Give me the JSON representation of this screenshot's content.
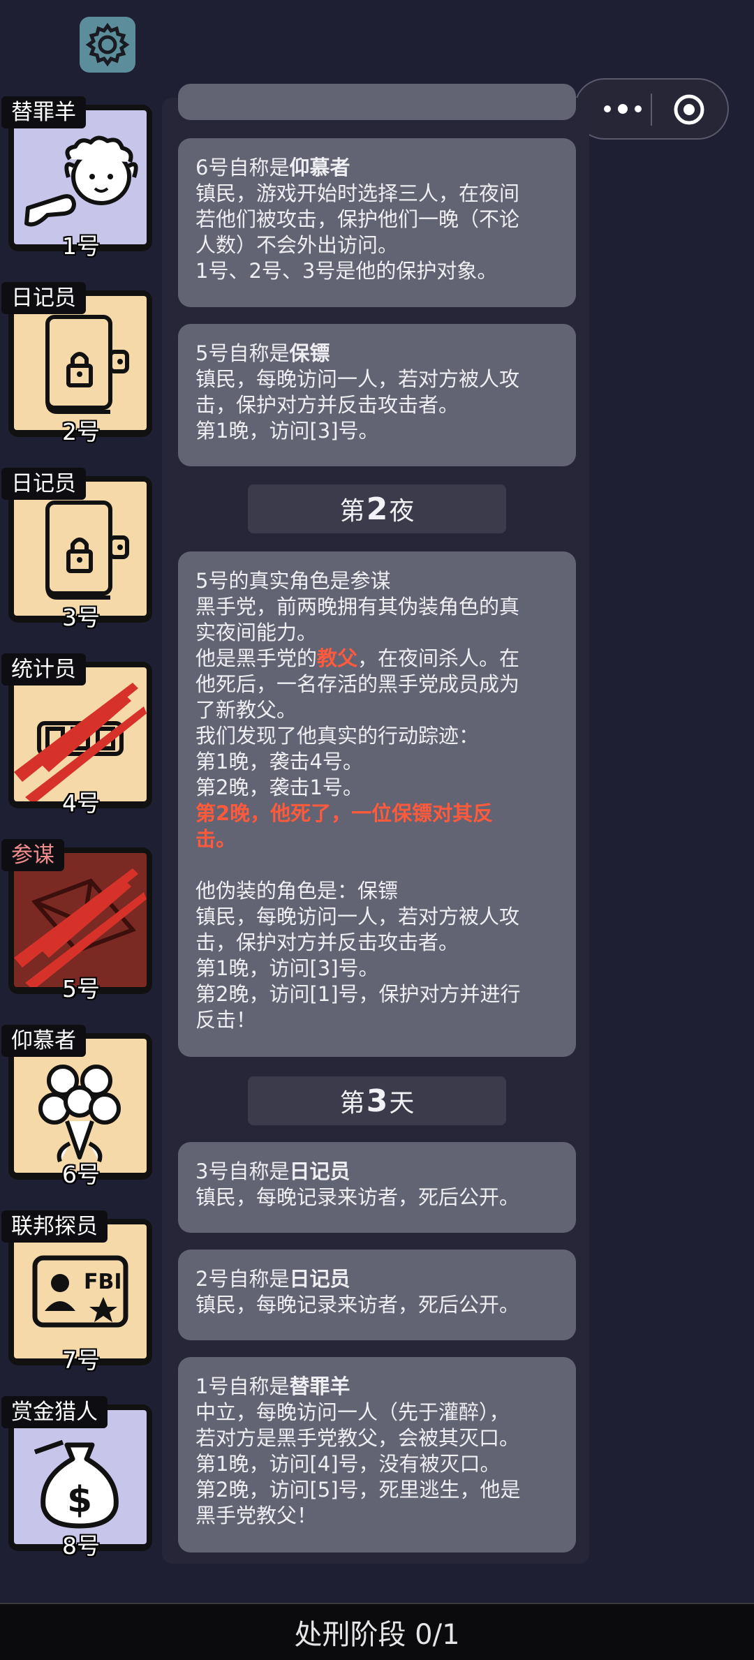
{
  "top": {
    "settings_icon": "gear-icon",
    "menu_icon": "more-dots-icon",
    "close_icon": "target-circle-icon"
  },
  "players": [
    {
      "role": "替罪羊",
      "number": "1号",
      "icon": "sheep-pointing-icon",
      "bg": "#c7c6ea",
      "status": "alive"
    },
    {
      "role": "日记员",
      "number": "2号",
      "icon": "locked-diary-icon",
      "bg": "#f5d9a8",
      "status": "alive"
    },
    {
      "role": "日记员",
      "number": "3号",
      "icon": "locked-diary-icon",
      "bg": "#f5d9a8",
      "status": "alive"
    },
    {
      "role": "统计员",
      "number": "4号",
      "icon": "counter-icon",
      "bg": "#f5d9a8",
      "status": "dead"
    },
    {
      "role": "参谋",
      "number": "5号",
      "icon": "envelope-icon",
      "bg": "#7a2a22",
      "status": "dead"
    },
    {
      "role": "仰慕者",
      "number": "6号",
      "icon": "rose-bouquet-icon",
      "bg": "#f5d9a8",
      "status": "alive"
    },
    {
      "role": "联邦探员",
      "number": "7号",
      "icon": "fbi-badge-icon",
      "bg": "#f5d9a8",
      "status": "alive"
    },
    {
      "role": "赏金猎人",
      "number": "8号",
      "icon": "money-bag-icon",
      "bg": "#c7c6ea",
      "status": "alive"
    }
  ],
  "log": {
    "card6": {
      "claim_prefix": "6号自称是",
      "claim_role": "仰慕者",
      "lines": [
        "镇民，游戏开始时选择三人，在夜间",
        "若他们被攻击，保护他们一晚（不论",
        "人数）不会外出访问。",
        "1号、2号、3号是他的保护对象。"
      ]
    },
    "card5": {
      "claim_prefix": "5号自称是",
      "claim_role": "保镖",
      "lines": [
        "镇民，每晚访问一人，若对方被人攻",
        "击，保护对方并反击攻击者。",
        "第1晚，访问[3]号。"
      ]
    },
    "night2": {
      "prefix": "第",
      "num": "2",
      "suffix": "夜"
    },
    "reveal": {
      "l1": "5号的真实角色是参谋",
      "l2": "黑手党，前两晚拥有其伪装角色的真",
      "l3": "实夜间能力。",
      "l4a": "他是黑手党的",
      "l4b": "教父",
      "l4c": "，在夜间杀人。在",
      "l5": "他死后，一名存活的黑手党成员成为",
      "l6": "了新教父。",
      "l7": "我们发现了他真实的行动踪迹：",
      "l8": "第1晚，袭击4号。",
      "l9": "第2晚，袭击1号。",
      "l10": "第2晚，他死了，一位保镖对其反",
      "l11": "击。",
      "l12": "他伪装的角色是：保镖",
      "l13": "镇民，每晚访问一人，若对方被人攻",
      "l14": "击，保护对方并反击攻击者。",
      "l15": "第1晚，访问[3]号。",
      "l16": "第2晚，访问[1]号，保护对方并进行",
      "l17": "反击！"
    },
    "day3": {
      "prefix": "第",
      "num": "3",
      "suffix": "天"
    },
    "card3": {
      "claim_prefix": "3号自称是",
      "claim_role": "日记员",
      "line": "镇民，每晚记录来访者，死后公开。"
    },
    "card2": {
      "claim_prefix": "2号自称是",
      "claim_role": "日记员",
      "line": "镇民，每晚记录来访者，死后公开。"
    },
    "card1": {
      "claim_prefix": "1号自称是",
      "claim_role": "替罪羊",
      "lines": [
        "中立，每晚访问一人（先于灌醉），",
        "若对方是黑手党教父，会被其灭口。",
        "第1晚，访问[4]号，没有被灭口。",
        "第2晚，访问[5]号，死里逃生，他是",
        "黑手党教父！"
      ]
    }
  },
  "bottom_bar": {
    "label": "处刑阶段 0/1"
  },
  "colors": {
    "background": "#1f1f33",
    "card": "#626373",
    "highlight": "#ff5a3c"
  }
}
